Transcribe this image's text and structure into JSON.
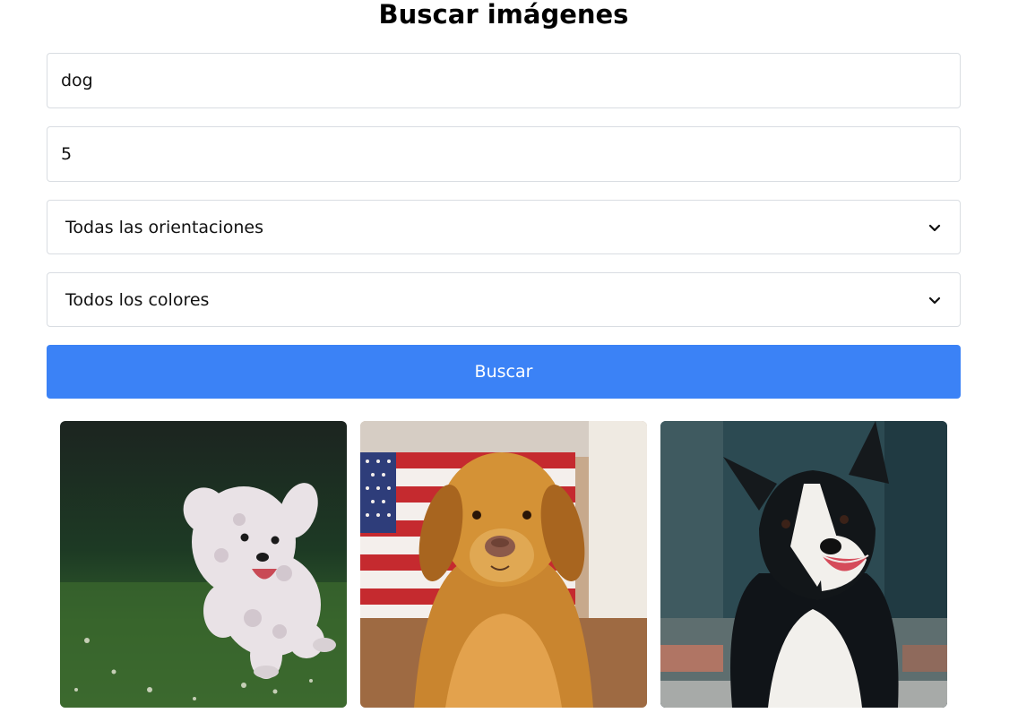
{
  "page": {
    "title": "Buscar imágenes"
  },
  "search": {
    "query_value": "dog",
    "count_value": "5",
    "orientation_selected": "Todas las orientaciones",
    "color_selected": "Todos los colores",
    "button_label": "Buscar"
  },
  "colors": {
    "accent": "#3b82f6",
    "field_border": "#d9dde2"
  },
  "results": [
    {
      "subject": "white curly dog running on grass"
    },
    {
      "subject": "golden retriever in front of US flag"
    },
    {
      "subject": "black and white border collie"
    }
  ]
}
